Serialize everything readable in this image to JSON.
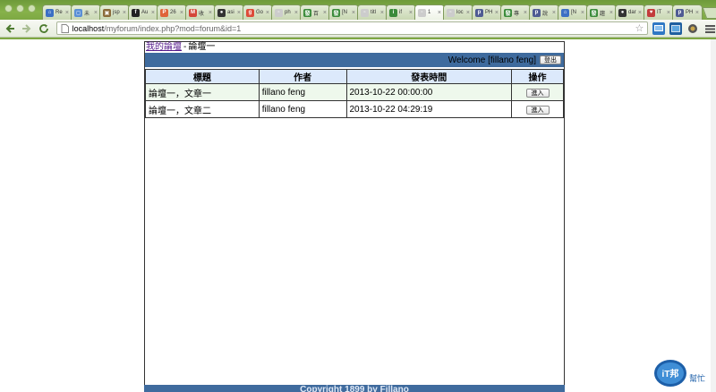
{
  "browser": {
    "tabs": [
      {
        "label": "Re",
        "color": "#3b6fc4",
        "glyph": "⌂"
      },
      {
        "label": "未",
        "color": "#5a8fd6",
        "glyph": "◻"
      },
      {
        "label": "jsp",
        "color": "#8b6b3a",
        "glyph": "▣"
      },
      {
        "label": "Au",
        "color": "#222222",
        "glyph": "f"
      },
      {
        "label": "26",
        "color": "#e0643a",
        "glyph": "P"
      },
      {
        "label": "收",
        "color": "#d44638",
        "glyph": "M"
      },
      {
        "label": "asi",
        "color": "#333333",
        "glyph": "●"
      },
      {
        "label": "Go",
        "color": "#dd4b39",
        "glyph": "g"
      },
      {
        "label": "ph",
        "color": "#cccccc",
        "glyph": "▫"
      },
      {
        "label": "百",
        "color": "#3a8b3a",
        "glyph": "發"
      },
      {
        "label": "[N",
        "color": "#3a8b3a",
        "glyph": "發"
      },
      {
        "label": "titl",
        "color": "#cccccc",
        "glyph": "▫"
      },
      {
        "label": "if",
        "color": "#3a8b3a",
        "glyph": "i"
      },
      {
        "label": "1",
        "color": "#cccccc",
        "glyph": "▫"
      },
      {
        "label": "loc",
        "color": "#cccccc",
        "glyph": "▫"
      },
      {
        "label": "PH",
        "color": "#4f5b93",
        "glyph": "p"
      },
      {
        "label": "專",
        "color": "#3a8b3a",
        "glyph": "發"
      },
      {
        "label": "說",
        "color": "#4f5b93",
        "glyph": "p"
      },
      {
        "label": "[N",
        "color": "#3b6fc4",
        "glyph": "⌂"
      },
      {
        "label": "趨",
        "color": "#3a8b3a",
        "glyph": "發"
      },
      {
        "label": "dar",
        "color": "#333333",
        "glyph": "●"
      },
      {
        "label": "IT",
        "color": "#c33c3c",
        "glyph": "♥"
      },
      {
        "label": "PH",
        "color": "#4f5b93",
        "glyph": "p"
      }
    ],
    "active_tab_index": 13,
    "url_host": "localhost",
    "url_path": "/myforum/index.php?mod=forum&id=1"
  },
  "breadcrumb": {
    "root": "我的論壇",
    "separator": "-",
    "current": "論壇一"
  },
  "welcome": {
    "text": "Welcome [fillano feng]",
    "logout_label": "登出"
  },
  "table": {
    "headers": [
      "標題",
      "作者",
      "發表時間",
      "操作"
    ],
    "rows": [
      {
        "title": "論壇一，文章一",
        "author": "fillano feng",
        "time": "2013-10-22 00:00:00",
        "action": "進入"
      },
      {
        "title": "論壇一，文章二",
        "author": "fillano feng",
        "time": "2013-10-22 04:29:19",
        "action": "進入"
      }
    ]
  },
  "footer": {
    "text": "Copyright 1899 by Fillano"
  },
  "watermark": {
    "line1": "iT邦",
    "line2": "幫忙"
  },
  "colors": {
    "header_bar": "#3f6b9e",
    "table_header": "#dce9fb",
    "row_odd": "#eef8ec",
    "chrome_green": "#7ea843"
  }
}
